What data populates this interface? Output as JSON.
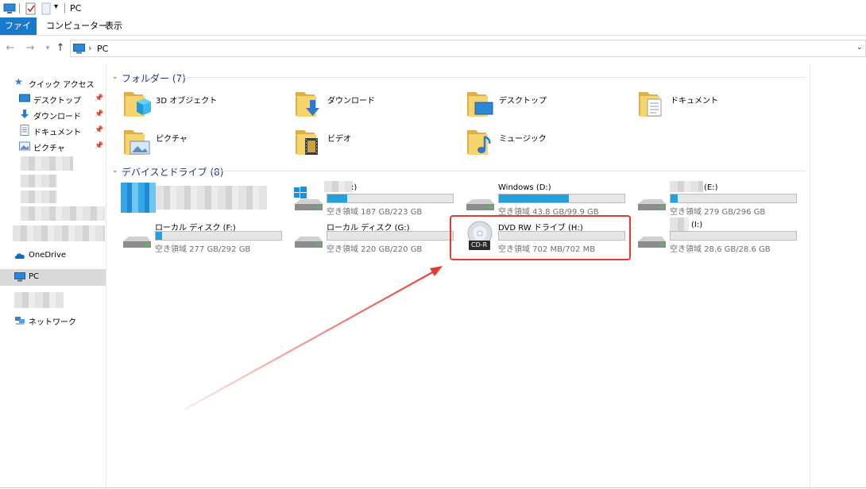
{
  "window": {
    "title": "PC"
  },
  "ribbon": {
    "tabs": [
      "ファイル",
      "コンピューター",
      "表示"
    ]
  },
  "address": {
    "path": "PC"
  },
  "sidebar": {
    "quick_access": "クイック アクセス",
    "pinned": [
      "デスクトップ",
      "ダウンロード",
      "ドキュメント",
      "ピクチャ"
    ],
    "onedrive": "OneDrive",
    "pc": "PC",
    "network": "ネットワーク"
  },
  "folders_group": {
    "title": "フォルダー (7)"
  },
  "folders": [
    "3D オブジェクト",
    "ダウンロード",
    "デスクトップ",
    "ドキュメント",
    "ピクチャ",
    "ビデオ",
    "ミュージック"
  ],
  "devices_group": {
    "title": "デバイスとドライブ (8)"
  },
  "drives": [
    {
      "name": "",
      "free_text": "",
      "used_fraction": 0
    },
    {
      "name": ":)",
      "free_text": "空き領域 187 GB/223 GB",
      "used_fraction": 0.16
    },
    {
      "name": "Windows (D:)",
      "free_text": "空き領域 43.8 GB/99.9 GB",
      "used_fraction": 0.56
    },
    {
      "name": "(E:)",
      "free_text": "空き領域 279 GB/296 GB",
      "used_fraction": 0.06
    },
    {
      "name": "ローカル ディスク (F:)",
      "free_text": "空き領域 277 GB/292 GB",
      "used_fraction": 0.05
    },
    {
      "name": "ローカル ディスク (G:)",
      "free_text": "空き領域 220 GB/220 GB",
      "used_fraction": 0.0
    },
    {
      "name": "DVD RW ドライブ (H:)",
      "free_text": "空き領域 702 MB/702 MB",
      "used_fraction": 0.0,
      "badge": "CD-R"
    },
    {
      "name": "(I:)",
      "free_text": "空き領域 28.6 GB/28.6 GB",
      "used_fraction": 0.0
    }
  ],
  "colors": {
    "accent": "#1979ca",
    "bar_fill": "#26a0da",
    "highlight": "#e63a2e",
    "group_title": "#1e3287"
  },
  "icons": {
    "folders": [
      "3d-objects-icon",
      "download-folder-icon",
      "desktop-folder-icon",
      "documents-folder-icon",
      "pictures-folder-icon",
      "videos-folder-icon",
      "music-folder-icon"
    ]
  }
}
